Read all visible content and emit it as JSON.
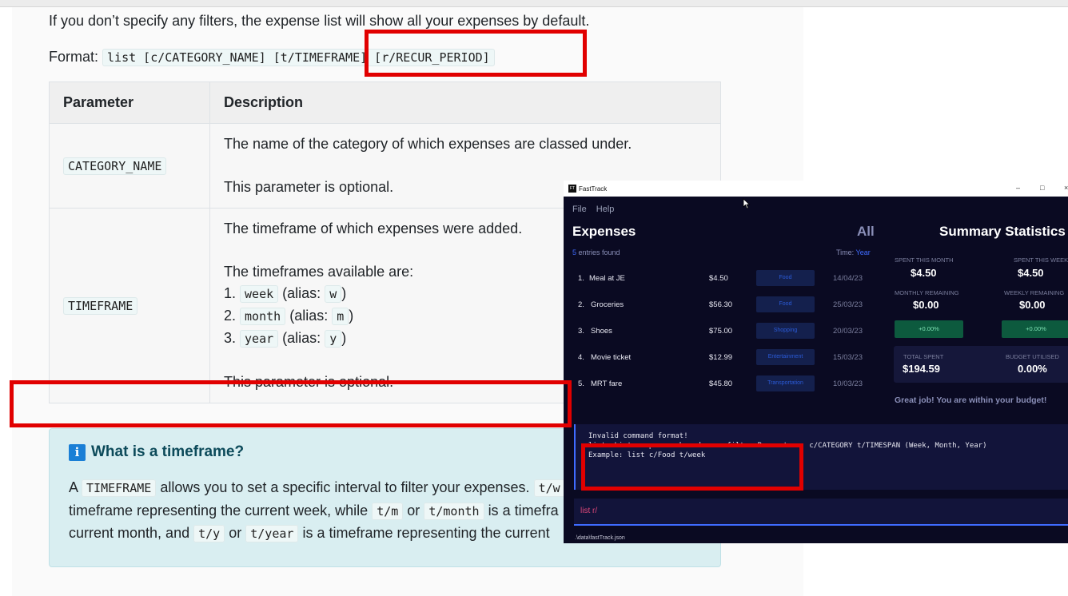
{
  "doc": {
    "intro": "If you don’t specify any filters, the expense list will show all your expenses by default.",
    "format_label": "Format:",
    "format_code": "list [c/CATEGORY_NAME] [t/TIMEFRAME] [r/RECUR_PERIOD]",
    "table": {
      "header_param": "Parameter",
      "header_desc": "Description",
      "row1_param": "CATEGORY_NAME",
      "row1_desc1": "The name of the category of which expenses are classed under.",
      "row1_desc2": "This parameter is optional.",
      "row2_param": "TIMEFRAME",
      "row2_desc1": "The timeframe of which expenses were added.",
      "row2_desc2": "The timeframes available are:",
      "tf1_num": "1.",
      "tf1_code": "week",
      "tf1_alias": "(alias:",
      "tf1_alias_code": "w",
      "tf1_close": ")",
      "tf2_num": "2.",
      "tf2_code": "month",
      "tf2_alias": "(alias:",
      "tf2_alias_code": "m",
      "tf2_close": ")",
      "tf3_num": "3.",
      "tf3_code": "year",
      "tf3_alias": "(alias:",
      "tf3_alias_code": "y",
      "tf3_close": ")",
      "row2_desc3": "This parameter is optional."
    },
    "info": {
      "icon": "i",
      "title": "What is a timeframe?",
      "l1_a": "A",
      "l1_code": "TIMEFRAME",
      "l1_b": "allows you to set a specific interval to filter your expenses.",
      "l1_code2": "t/w",
      "l2_a": "timeframe representing the current week, while",
      "l2_code1": "t/m",
      "l2_or": "or",
      "l2_code2": "t/month",
      "l2_b": "is a timefra",
      "l3_a": "current month, and",
      "l3_code1": "t/y",
      "l3_or": "or",
      "l3_code2": "t/year",
      "l3_b": "is a timeframe representing the current"
    }
  },
  "app": {
    "window_title": "FastTrack",
    "icon_text": "FT",
    "controls": {
      "min": "–",
      "max": "□",
      "close": "×"
    },
    "menu": [
      "File",
      "Help"
    ],
    "expenses_title": "Expenses",
    "filter_label": "All",
    "entries_count": "5",
    "entries_text": "entries found",
    "time_label": "Time:",
    "time_value": "Year",
    "expenses": [
      {
        "idx": "1.",
        "name": "Meal at JE",
        "amount": "$4.50",
        "category": "Food",
        "date": "14/04/23"
      },
      {
        "idx": "2.",
        "name": "Groceries",
        "amount": "$56.30",
        "category": "Food",
        "date": "25/03/23"
      },
      {
        "idx": "3.",
        "name": "Shoes",
        "amount": "$75.00",
        "category": "Shopping",
        "date": "20/03/23"
      },
      {
        "idx": "4.",
        "name": "Movie ticket",
        "amount": "$12.99",
        "category": "Entertainment",
        "date": "15/03/23"
      },
      {
        "idx": "5.",
        "name": "MRT fare",
        "amount": "$45.80",
        "category": "Transportation",
        "date": "10/03/23"
      }
    ],
    "summary": {
      "title": "Summary Statistics",
      "spent_month_label": "SPENT THIS MONTH",
      "spent_month_value": "$4.50",
      "spent_week_label": "SPENT THIS WEEK",
      "spent_week_value": "$4.50",
      "monthly_remaining_label": "MONTHLY REMAINING",
      "monthly_remaining_value": "$0.00",
      "weekly_remaining_label": "WEEKLY REMAINING",
      "weekly_remaining_value": "$0.00",
      "pct_month": "+0.00%",
      "pct_week": "+0.00%",
      "total_spent_label": "TOTAL SPENT",
      "total_spent_value": "$194.59",
      "budget_utilised_label": "BUDGET UTILISED",
      "budget_utilised_value": "0.00%",
      "message": "Great job! You are within your budget!"
    },
    "console": {
      "line1": "Invalid command format!",
      "line2": "list: Lists expenses based on a filter.Parameters: c/CATEGORY t/TIMESPAN (Week, Month, Year)",
      "line3": "Example: list c/Food t/week"
    },
    "command_input": "list r/",
    "status_path": ".\\data\\fastTrack.json"
  }
}
